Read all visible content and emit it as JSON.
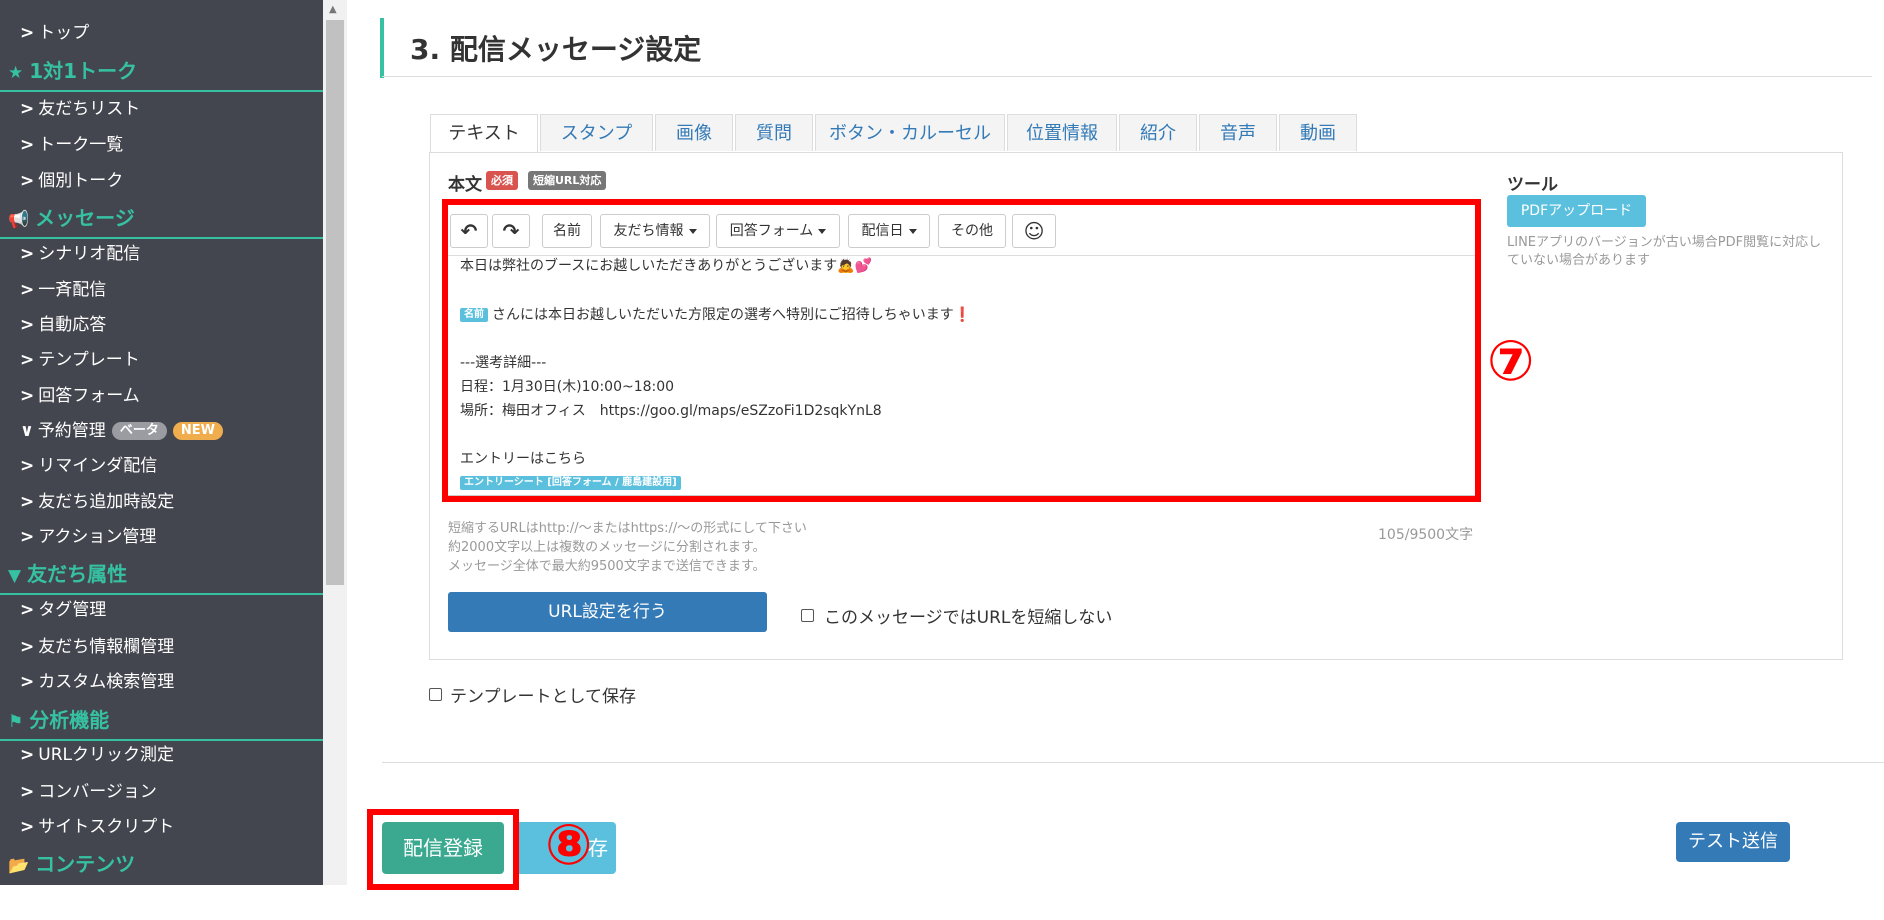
{
  "sidebar": {
    "items": [
      {
        "type": "item",
        "label": "トップ"
      },
      {
        "type": "header",
        "icon": "star-icon",
        "glyph": "★",
        "label": "1対1トーク"
      },
      {
        "type": "item",
        "label": "友だちリスト"
      },
      {
        "type": "item",
        "label": "トーク一覧"
      },
      {
        "type": "item",
        "label": "個別トーク"
      },
      {
        "type": "header",
        "icon": "megaphone-icon",
        "glyph": "📢",
        "label": "メッセージ"
      },
      {
        "type": "item",
        "label": "シナリオ配信"
      },
      {
        "type": "item",
        "label": "一斉配信"
      },
      {
        "type": "item",
        "label": "自動応答"
      },
      {
        "type": "item",
        "label": "テンプレート"
      },
      {
        "type": "item",
        "label": "回答フォーム"
      },
      {
        "type": "item",
        "label": "予約管理",
        "expanded": true,
        "tags": [
          "ベータ",
          "NEW"
        ]
      },
      {
        "type": "item",
        "label": "リマインダ配信"
      },
      {
        "type": "item",
        "label": "友だち追加時設定"
      },
      {
        "type": "item",
        "label": "アクション管理"
      },
      {
        "type": "header",
        "icon": "filter-icon",
        "glyph": "▼",
        "label": "友だち属性"
      },
      {
        "type": "item",
        "label": "タグ管理"
      },
      {
        "type": "item",
        "label": "友だち情報欄管理"
      },
      {
        "type": "item",
        "label": "カスタム検索管理"
      },
      {
        "type": "header",
        "icon": "flag-icon",
        "glyph": "⚑",
        "label": "分析機能"
      },
      {
        "type": "item",
        "label": "URLクリック測定"
      },
      {
        "type": "item",
        "label": "コンバージョン"
      },
      {
        "type": "item",
        "label": "サイトスクリプト"
      },
      {
        "type": "header",
        "icon": "folder-icon",
        "glyph": "📂",
        "label": "コンテンツ"
      }
    ]
  },
  "section": {
    "title": "3. 配信メッセージ設定"
  },
  "tabs": [
    "テキスト",
    "スタンプ",
    "画像",
    "質問",
    "ボタン・カルーセル",
    "位置情報",
    "紹介",
    "音声",
    "動画"
  ],
  "active_tab": 0,
  "editor": {
    "body_label": "本文",
    "required_label": "必須",
    "short_url_label": "短縮URL対応",
    "toolbar": {
      "undo_glyph": "↶",
      "redo_glyph": "↷",
      "name": "名前",
      "friend_info": "友だち情報",
      "answer_form": "回答フォーム",
      "send_date": "配信日",
      "other": "その他",
      "emoji_glyph": "☺"
    },
    "lines": [
      "本日は弊社のブースにお越しいただきありがとうございます🙇💕",
      "",
      "さんには本日お越しいただいた方限定の選考へ特別にご招待しちゃいます❗",
      "",
      "---選考詳細---",
      "日程：1月30日(木)10:00~18:00",
      "場所：梅田オフィス　https://goo.gl/maps/eSZzoFi1D2sqkYnL8",
      "",
      "エントリーはこちら",
      ""
    ],
    "name_chip": "名前",
    "form_chip": "エントリーシート [回答フォーム / 鹿島建設用]",
    "hints": [
      "短縮するURLはhttp://〜またはhttps://〜の形式にして下さい",
      "約2000文字以上は複数のメッセージに分割されます。",
      "メッセージ全体で最大約9500文字まで送信できます。"
    ],
    "char_count": "105/9500文字",
    "url_button": "URL設定を行う",
    "no_shorten_label": "このメッセージではURLを短縮しない"
  },
  "tools": {
    "title": "ツール",
    "pdf_button": "PDFアップロード",
    "note": "LINEアプリのバージョンが古い場合PDF閲覧に対応していない場合があります"
  },
  "save_template_label": "テンプレートとして保存",
  "footer": {
    "submit_button": "配信登録",
    "save_button": "存",
    "test_button": "テスト送信"
  },
  "annotations": {
    "seven": "⑦",
    "eight": "⑧"
  }
}
